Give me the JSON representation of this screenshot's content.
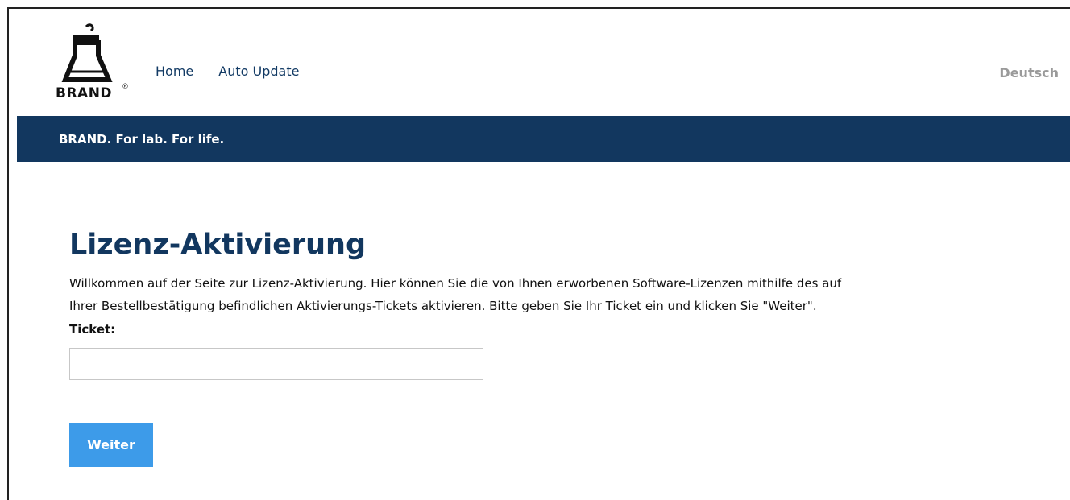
{
  "brand": {
    "logo_text": "BRAND",
    "registered_mark": "®"
  },
  "nav": {
    "items": [
      {
        "label": "Home"
      },
      {
        "label": "Auto Update"
      }
    ],
    "language": "Deutsch"
  },
  "banner": {
    "tagline": "BRAND. For lab. For life."
  },
  "main": {
    "title": "Lizenz-Aktivierung",
    "intro_line1": "Willkommen auf der Seite zur Lizenz-Aktivierung. Hier können Sie die von Ihnen erworbenen Software-Lizenzen mithilfe des auf",
    "intro_line2": "Ihrer Bestellbestätigung befindlichen Aktivierungs-Tickets aktivieren. Bitte geben Sie Ihr Ticket ein und klicken Sie \"Weiter\".",
    "ticket_label": "Ticket:",
    "ticket_value": "",
    "submit_label": "Weiter"
  },
  "colors": {
    "navy": "#12375f",
    "button_blue": "#3d9be9",
    "language_gray": "#9a9a9a"
  }
}
